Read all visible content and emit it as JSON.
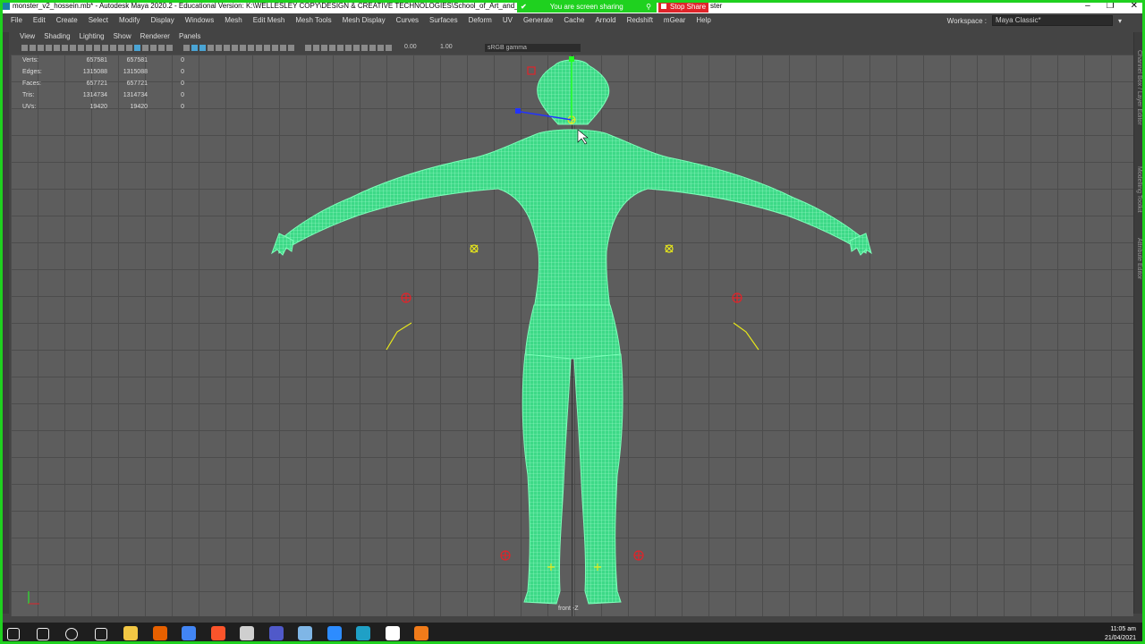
{
  "titlebar": {
    "title": "monster_v2_hossein.mb* - Autodesk Maya 2020.2 - Educational Version: K:\\WELLESLEY COPY\\DESIGN & CREATIVE TECHNOLOGIES\\School_of_Art_and_Design\\",
    "share_text": "You are screen sharing",
    "stop_label": "Stop Share",
    "title_tail": "ster"
  },
  "menu": [
    "File",
    "Edit",
    "Create",
    "Select",
    "Modify",
    "Display",
    "Windows",
    "Mesh",
    "Edit Mesh",
    "Mesh Tools",
    "Mesh Display",
    "Curves",
    "Surfaces",
    "Deform",
    "UV",
    "Generate",
    "Cache",
    "Arnold",
    "Redshift",
    "mGear",
    "Help"
  ],
  "workspace": {
    "label": "Workspace :",
    "value": "Maya Classic*"
  },
  "panel_menu": [
    "View",
    "Shading",
    "Lighting",
    "Show",
    "Renderer",
    "Panels"
  ],
  "toolbar": {
    "field1": "0.00",
    "field2": "1.00",
    "gamma": "sRGB gamma"
  },
  "hud": {
    "rows": [
      {
        "label": "Verts:",
        "v1": "657581",
        "v2": "657581",
        "v3": "0"
      },
      {
        "label": "Edges:",
        "v1": "1315088",
        "v2": "1315088",
        "v3": "0"
      },
      {
        "label": "Faces:",
        "v1": "657721",
        "v2": "657721",
        "v3": "0"
      },
      {
        "label": "Tris:",
        "v1": "1314734",
        "v2": "1314734",
        "v3": "0"
      },
      {
        "label": "UVs:",
        "v1": "19420",
        "v2": "19420",
        "v3": "0"
      }
    ]
  },
  "viewport": {
    "camera_label": "front -Z",
    "wire_color": "#59f59a",
    "controller_color": "#e8e81a",
    "accent_red": "#e0242a"
  },
  "right_shelf": [
    "Channel Box / Layer Editor",
    "Modelling Toolkit",
    "Attribute Editor"
  ],
  "taskbar": {
    "icons": [
      "windows-start-icon",
      "search-icon",
      "cortana-icon",
      "task-view-icon",
      "file-explorer-icon",
      "firefox-icon",
      "chrome-icon",
      "brave-icon",
      "settings-icon",
      "teams-icon",
      "notes-icon",
      "zoom-icon",
      "maya-icon",
      "docs-icon",
      "app-icon"
    ],
    "time": "11:05 am",
    "date": "21/04/2021"
  }
}
